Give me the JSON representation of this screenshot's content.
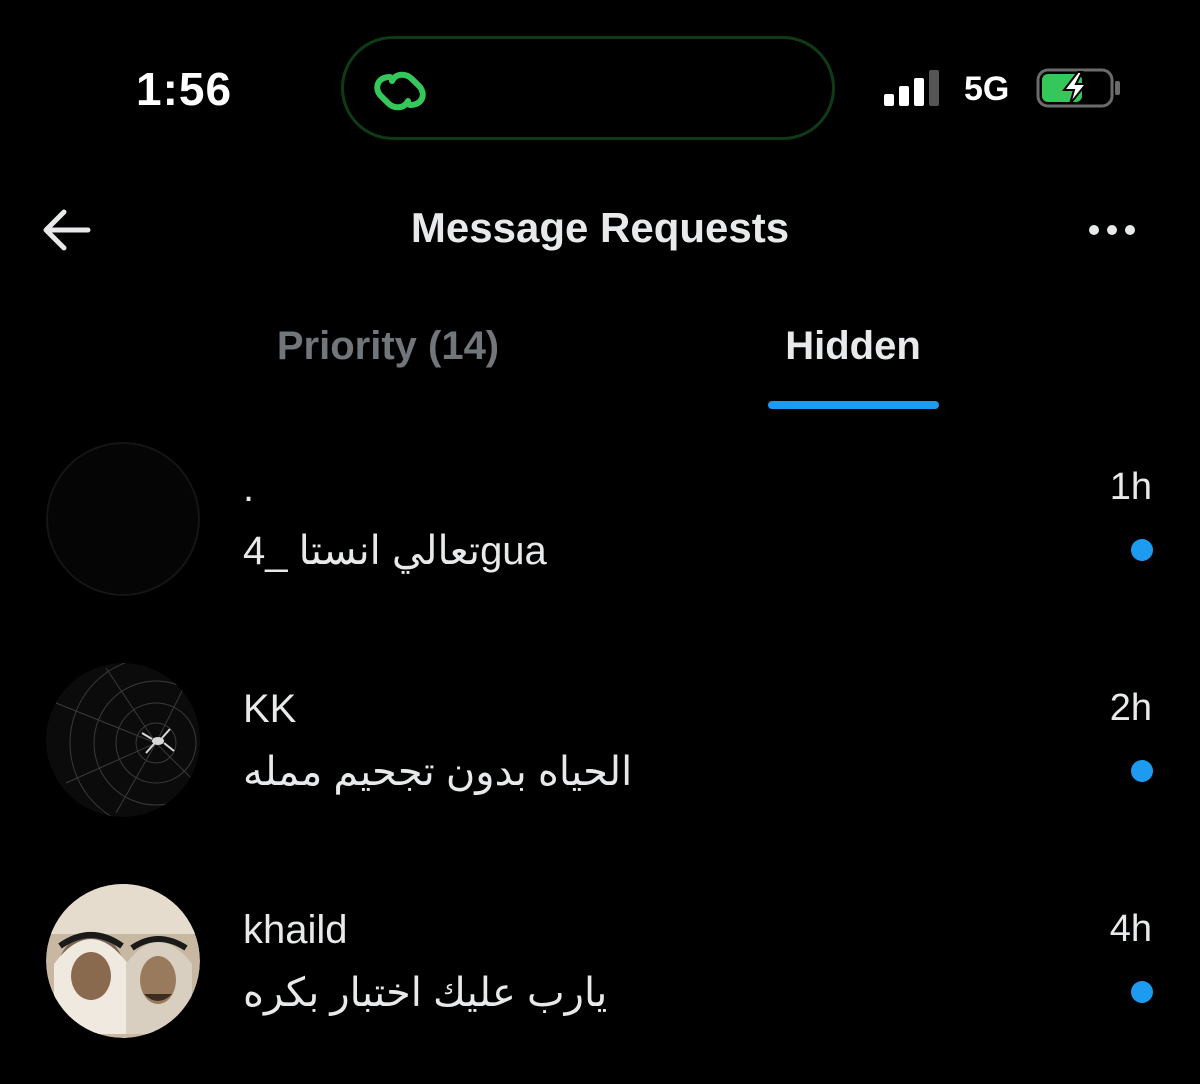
{
  "status_bar": {
    "time": "1:56",
    "network": "5G",
    "island_icon": "link-loop-icon",
    "signal_icon": "cellular-signal-icon",
    "battery_icon": "battery-charging-icon",
    "accent_green": "#34c759"
  },
  "header": {
    "title": "Message Requests",
    "back_icon": "arrow-left-icon",
    "more_icon": "more-horizontal-icon"
  },
  "tabs": [
    {
      "label": "Priority (14)",
      "selected": false
    },
    {
      "label": "Hidden",
      "selected": true
    }
  ],
  "conversations": [
    {
      "name": ".",
      "preview": "تعالي انستا _4gua",
      "time": "1h",
      "unread": true
    },
    {
      "name": "KK",
      "preview": "الحياه بدون تجحيم ممله",
      "time": "2h",
      "unread": true
    },
    {
      "name": "khaild",
      "preview": "يارب عليك اختبار بكره",
      "time": "4h",
      "unread": true
    }
  ],
  "colors": {
    "background": "#000000",
    "text_primary": "#e7e9ea",
    "text_secondary": "#71767b",
    "accent_blue": "#1d9bf0"
  }
}
